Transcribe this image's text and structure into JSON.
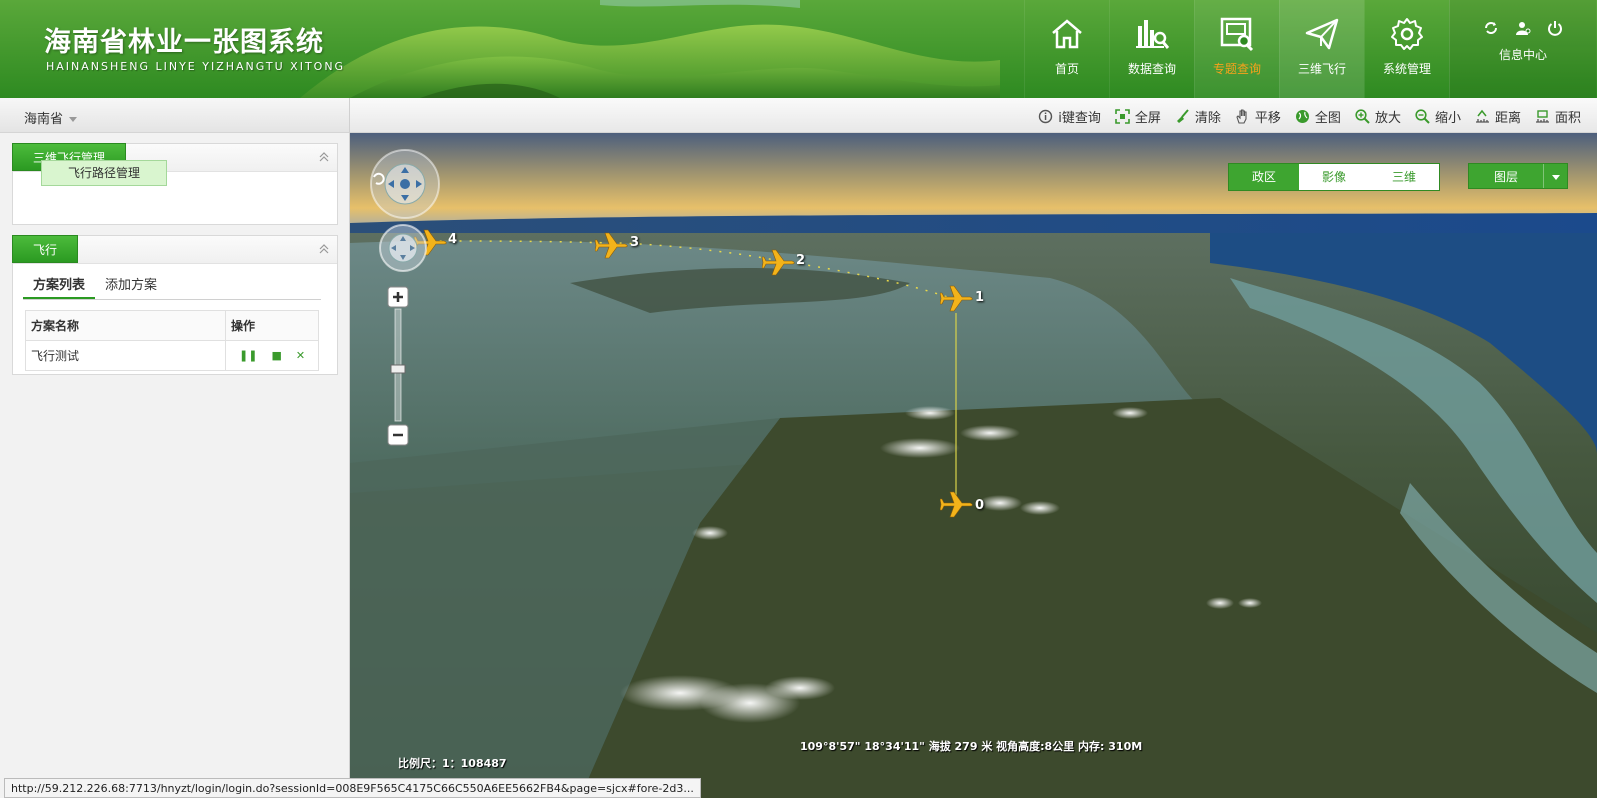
{
  "header": {
    "title_cn": "海南省林业一张图系统",
    "title_en": "HAINANSHENG LINYE YIZHANGTU XITONG",
    "nav": [
      {
        "label": "首页",
        "icon": "home-icon"
      },
      {
        "label": "数据查询",
        "icon": "data-query-icon"
      },
      {
        "label": "专题查询",
        "icon": "theme-query-icon"
      },
      {
        "label": "三维飞行",
        "icon": "paper-plane-icon"
      },
      {
        "label": "系统管理",
        "icon": "gear-icon"
      }
    ],
    "info_center": "信息中心",
    "orange_color": "#f7a21b",
    "brand_green": "#2f8a22"
  },
  "region": {
    "selected": "海南省"
  },
  "toolbar": {
    "items": [
      {
        "label": "i键查询",
        "icon": "info-icon"
      },
      {
        "label": "全屏",
        "icon": "fullscreen-icon"
      },
      {
        "label": "清除",
        "icon": "broom-icon"
      },
      {
        "label": "平移",
        "icon": "hand-icon"
      },
      {
        "label": "全图",
        "icon": "globe-icon"
      },
      {
        "label": "放大",
        "icon": "zoom-in-icon"
      },
      {
        "label": "缩小",
        "icon": "zoom-out-icon"
      },
      {
        "label": "距离",
        "icon": "ruler-icon"
      },
      {
        "label": "面积",
        "icon": "area-icon"
      }
    ]
  },
  "panels": {
    "flight_manage": {
      "title": "三维飞行管理",
      "button": "飞行路径管理"
    },
    "flight": {
      "title": "飞行",
      "tabs": [
        "方案列表",
        "添加方案"
      ],
      "table": {
        "headers": [
          "方案名称",
          "操作"
        ],
        "rows": [
          {
            "name": "飞行测试",
            "ops": [
              "pause",
              "stop",
              "delete"
            ]
          }
        ]
      }
    }
  },
  "map": {
    "view_switch": [
      "政区",
      "影像",
      "三维"
    ],
    "active_view": "政区",
    "layers_label": "图层",
    "waypoints": [
      "0",
      "1",
      "2",
      "3",
      "4"
    ],
    "status": "109°8'57\" 18°34'11\" 海拔 279 米  视角高度:8公里  内存: 310M",
    "scale": "比例尺：1：108487"
  },
  "status_url": "http://59.212.226.68:7713/hnyzt/login/login.do?sessionId=008E9F565C4175C66C550A6EE5662FB4&page=sjcx#fore-2d3..."
}
